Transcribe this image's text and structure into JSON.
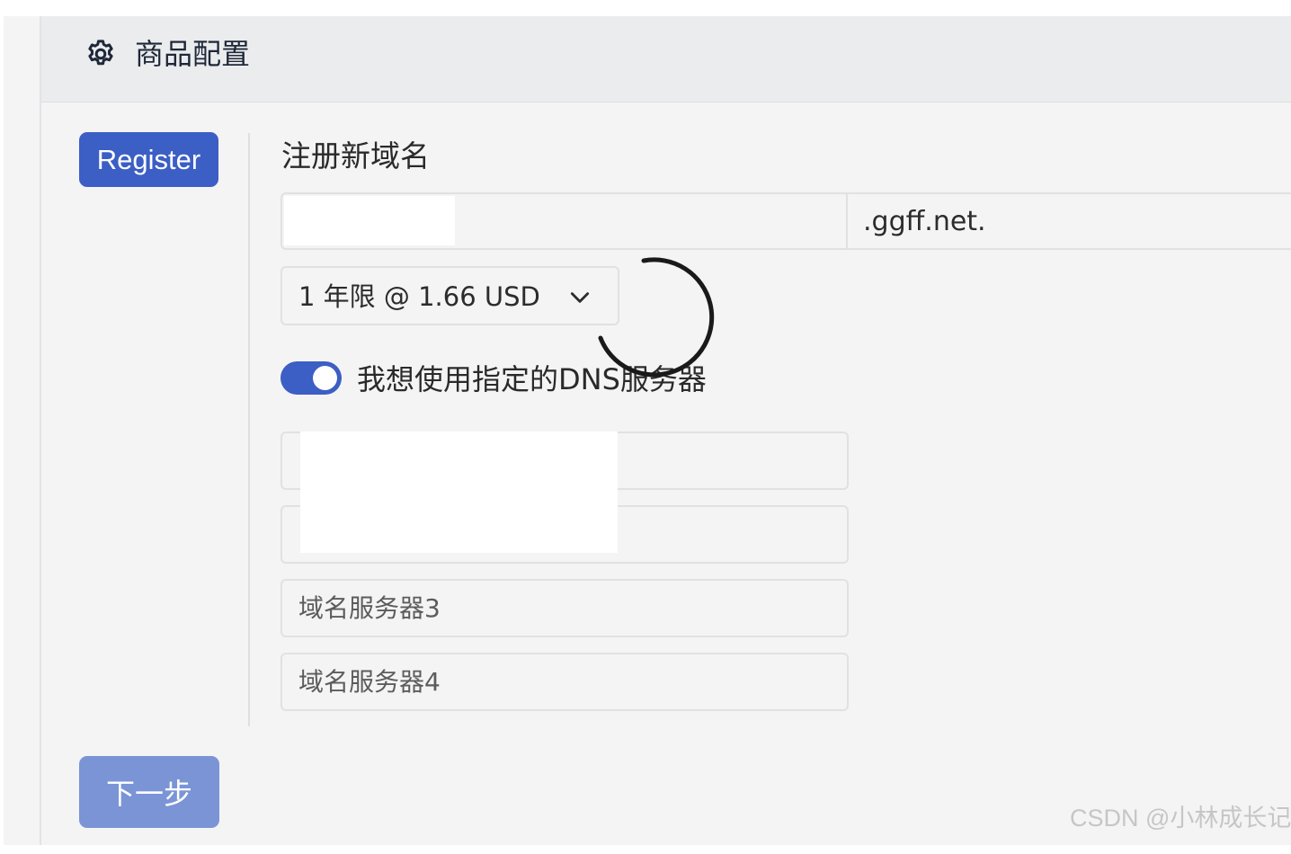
{
  "header": {
    "title": "商品配置",
    "icon": "gear-icon"
  },
  "sidebar": {
    "register_label": "Register",
    "next_label": "下一步"
  },
  "form": {
    "section_title": "注册新域名",
    "domain_input_value": "",
    "domain_suffix": ".ggff.net.",
    "period_selected": "1 年限 @ 1.66 USD",
    "dns_toggle_label": "我想使用指定的DNS服务器",
    "dns_toggle_on": true,
    "nameservers": [
      {
        "value": "",
        "placeholder": ""
      },
      {
        "value": "",
        "placeholder": ""
      },
      {
        "value": "",
        "placeholder": "域名服务器3"
      },
      {
        "value": "",
        "placeholder": "域名服务器4"
      }
    ]
  },
  "colors": {
    "primary": "#3b5fc4",
    "primary_disabled": "#7b94d6",
    "header_bg": "#ebecee",
    "page_bg": "#f4f4f4"
  },
  "watermark": "CSDN @小林成长记"
}
